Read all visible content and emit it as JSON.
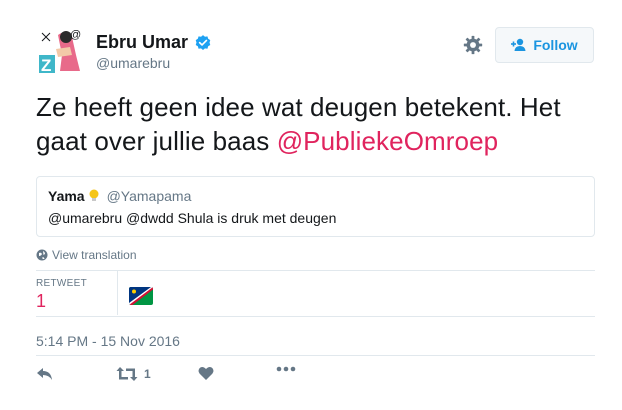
{
  "header": {
    "display_name": "Ebru Umar",
    "screen_name": "@umarebru",
    "follow_label": "Follow",
    "verified": true,
    "avatar_icon": "avatar-illustration",
    "gear_icon": "gear-icon"
  },
  "tweet": {
    "text_before": "Ze heeft geen idee wat deugen betekent. Het gaat over jullie baas ",
    "mention": "@PubliekeOmroep"
  },
  "quoted_tweet": {
    "name": "Yama",
    "name_emoji_icon": "lightbulb-icon",
    "handle": "@Yamapama",
    "text": "@umarebru @dwdd Shula is druk met deugen"
  },
  "translation": {
    "label": "View translation",
    "icon": "globe-icon"
  },
  "stats": {
    "retweet_label": "RETWEET",
    "retweet_count": "1"
  },
  "timestamp": "5:14 PM - 15 Nov 2016",
  "actions": {
    "reply_icon": "reply-icon",
    "retweet_icon": "retweet-icon",
    "retweet_count": "1",
    "like_icon": "heart-icon",
    "more_icon": "more-dots-icon"
  },
  "colors": {
    "mention": "#e0245e",
    "follow_blue": "#1b95e0",
    "muted": "#657786",
    "border": "#e1e8ed",
    "verified": "#1da1f2"
  }
}
